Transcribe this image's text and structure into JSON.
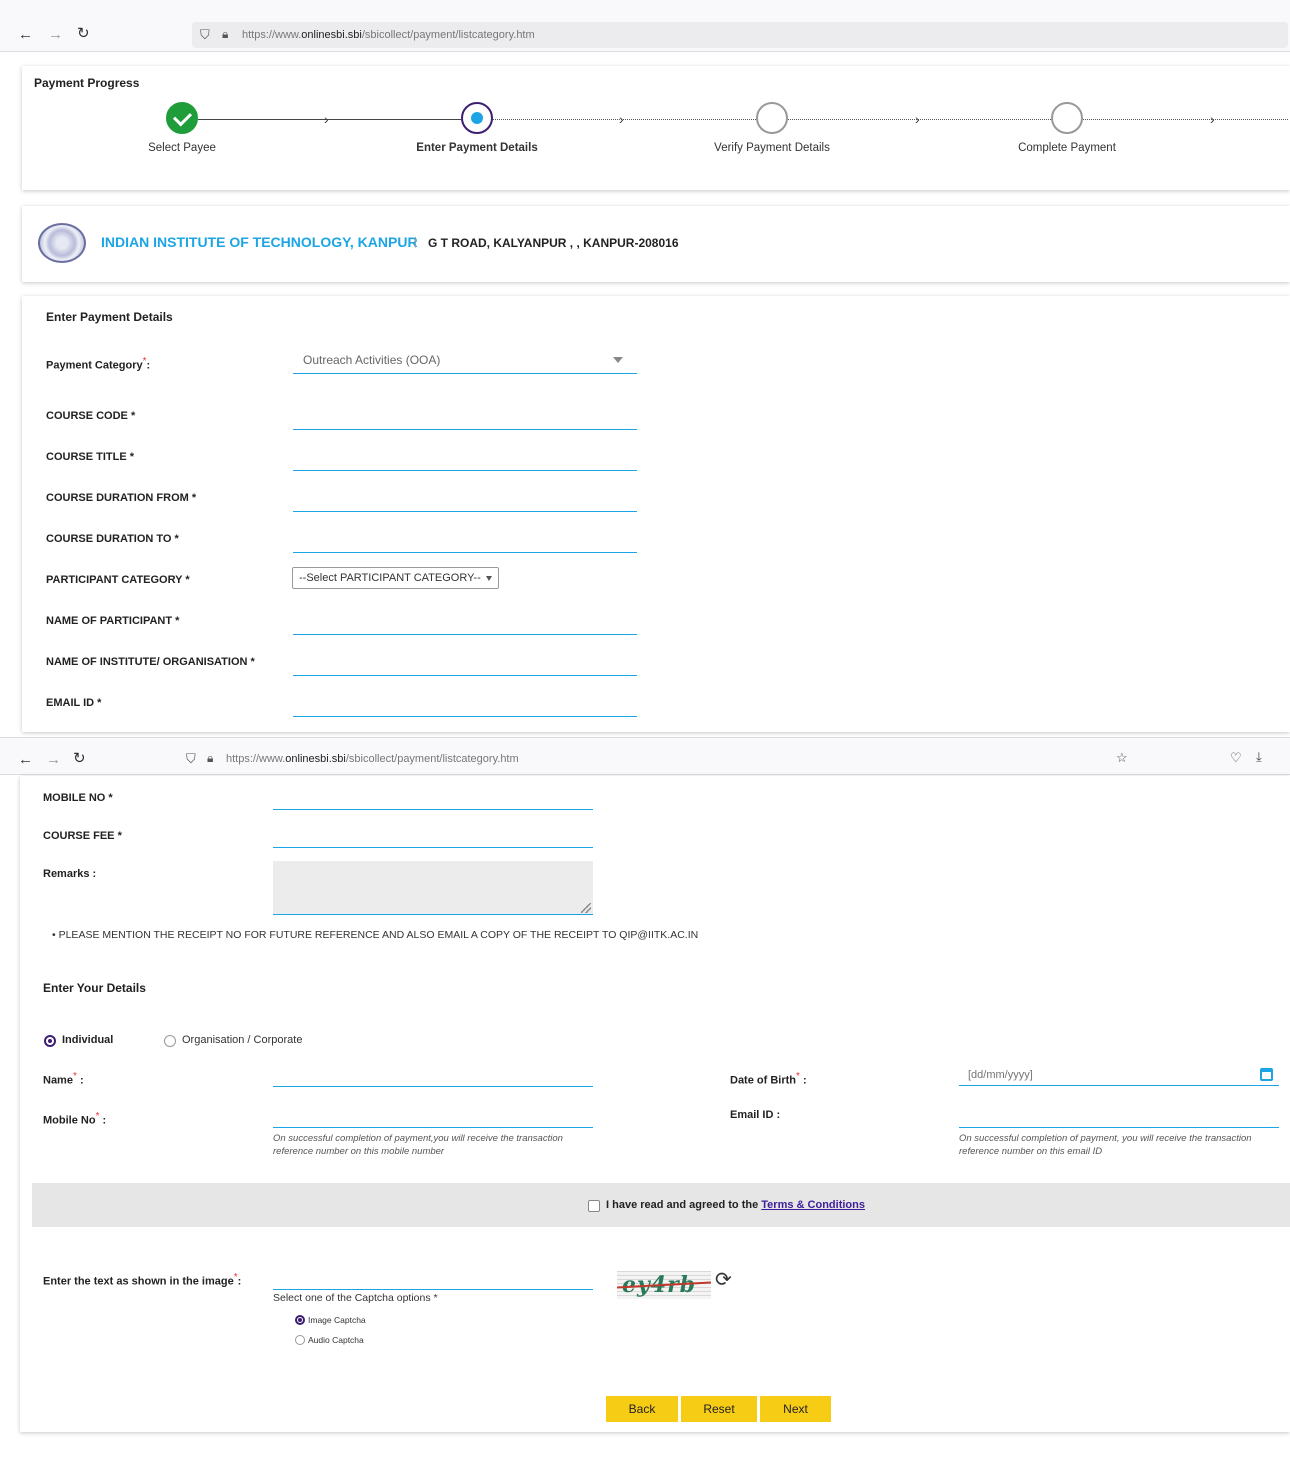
{
  "browser": {
    "url_prefix": "https://www.",
    "url_domain": "onlinesbi.sbi",
    "url_path": "/sbicollect/payment/listcategory.htm"
  },
  "progress": {
    "title": "Payment Progress",
    "steps": [
      {
        "label": "Select Payee",
        "state": "done"
      },
      {
        "label": "Enter Payment Details",
        "state": "active"
      },
      {
        "label": "Verify Payment Details",
        "state": "pending"
      },
      {
        "label": "Complete Payment",
        "state": "pending"
      }
    ]
  },
  "institute": {
    "name": "INDIAN INSTITUTE OF TECHNOLOGY, KANPUR",
    "separator": "|",
    "address": "G T ROAD, KALYANPUR , , KANPUR-208016"
  },
  "payment": {
    "title": "Enter Payment Details",
    "category_label": "Payment Category",
    "category_suffix": ":",
    "category_value": "Outreach Activities (OOA)",
    "fields": {
      "course_code": "COURSE CODE *",
      "course_title": "COURSE TITLE *",
      "duration_from": "COURSE DURATION FROM *",
      "duration_to": "COURSE DURATION TO *",
      "participant_category": "PARTICIPANT CATEGORY *",
      "participant_category_value": "--Select PARTICIPANT CATEGORY--",
      "participant_name": "NAME OF PARTICIPANT *",
      "institute_name": "NAME OF INSTITUTE/ ORGANISATION *",
      "email": "EMAIL ID *",
      "mobile": "MOBILE NO *",
      "course_fee": "COURSE FEE *",
      "remarks": "Remarks :"
    },
    "note": "• PLEASE MENTION THE RECEIPT NO FOR FUTURE REFERENCE AND ALSO EMAIL A COPY OF THE RECEIPT TO QIP@IITK.AC.IN"
  },
  "your_details": {
    "title": "Enter Your Details",
    "type_individual": "Individual",
    "type_org": "Organisation / Corporate",
    "name_label": "Name",
    "dob_label": "Date of Birth",
    "dob_placeholder": "[dd/mm/yyyy]",
    "mobile_label": "Mobile No",
    "email_label": "Email ID :",
    "colon": ":",
    "req_mark": "*",
    "mobile_hint": "On successful completion of payment,you will receive the transaction reference number on this mobile number",
    "email_hint": "On successful completion of payment, you will receive the transaction reference number on this email ID"
  },
  "terms": {
    "text": "I have read and agreed to the ",
    "link": "Terms & Conditions"
  },
  "captcha": {
    "label": "Enter the text as shown in the image",
    "image_text": "ey4rb",
    "options_label": "Select one of the Captcha options *",
    "option_image": "Image Captcha",
    "option_audio": "Audio Captcha"
  },
  "buttons": {
    "back": "Back",
    "reset": "Reset",
    "next": "Next"
  },
  "colors": {
    "accent": "#1ba5e5",
    "done": "#1f9d3a",
    "active_ring": "#3d1e73",
    "button": "#f7cc15"
  }
}
